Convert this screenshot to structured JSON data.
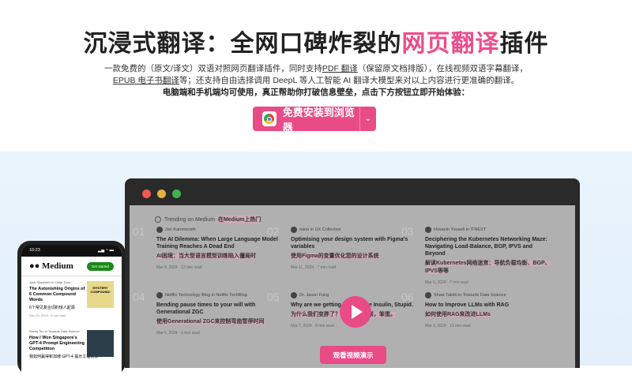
{
  "hero": {
    "title_pre": "沉浸式翻译：全网口碑炸裂的",
    "title_hl": "网页翻译",
    "title_post": "插件",
    "desc1": "一款免费的（原文/译文）双语对照网页翻译插件，同时支持",
    "pdf_link": "PDF 翻译",
    "desc2": "（保留原文档排版），在线视频双语字幕翻译，",
    "epub_link": "EPUB 电子书翻译",
    "desc3": "等；还支持自由选择调用 DeepL 等人工智能 AI 翻译大模型来对以上内容进行更准确的翻译。",
    "desc_bold": "电脑端和手机端均可使用，真正帮助你打破信息壁垒，点击下方按钮立即开始体验：",
    "install_label": "免费安装到浏览器",
    "dropdown_icon": "chevron-down-icon"
  },
  "colors": {
    "accent": "#e94b87"
  },
  "demo": {
    "trending": "Trending on Medium",
    "trending_zh": "在Medium上热门",
    "watch_label": "观看视频演示",
    "cards": [
      {
        "num": "01",
        "author": "Jan Kammerath",
        "title": "The AI Dilemma: When Large Language Model Training Reaches A Dead End",
        "zh": "AI困境：当大型语言模型训练陷入僵局时",
        "meta": "Mar 9, 2024 · 12 min read"
      },
      {
        "num": "02",
        "author": "nana in UX Collective",
        "title": "Optimising your design system with Figma's variables",
        "zh": "使用Figma的变量优化您的设计系统",
        "meta": "Mar 11, 2024 · 7 min read"
      },
      {
        "num": "03",
        "author": "Hossein Yousefi in ITNEXT",
        "title": "Deciphering the Kubernetes Networking Maze: Navigating Load-Balance, BGP, IPVS and Beyond",
        "zh": "解读Kubernetes网络迷宫：导航负载均衡、BGP、IPVS等等",
        "meta": "Mar 6, 2024 · 7 min read"
      },
      {
        "num": "04",
        "author": "Netflix Technology Blog in Netflix TechBlog",
        "title": "Bending pause times to your will with Generational ZGC",
        "zh": "使用Generational ZGC来控制弯曲暂停时间",
        "meta": "Mar 6, 2024 · 6 min read"
      },
      {
        "num": "05",
        "author": "Dr. Jason Fung",
        "title": "Why are we getting fat? It's the Insulin, Stupid.",
        "zh": "为什么我们变胖了？是因为胰岛素，笨蛋。",
        "meta": "Mar 7, 2024 · 8 min read"
      },
      {
        "num": "06",
        "author": "Shaw Talebi in Towards Data Science",
        "title": "How to Improve LLMs with RAG",
        "zh": "如何使用RAG来改进LLMs",
        "meta": "Mar 9, 2024 · 12 min read"
      }
    ]
  },
  "phone": {
    "time": "10:23",
    "logo": "Medium",
    "get_started": "Get started",
    "items": [
      {
        "author": "Jack Shepherd in Cellar Door",
        "title": "The Astonishing Origins of 6 Common Compound Words",
        "zh": "6个常见复合词的惊人起源",
        "meta": "Dec 20, 2023 · 5 min read",
        "img": "MYSTERY COMPOUND!"
      },
      {
        "author": "Sheila Teo in Towards Data Science",
        "title": "How I Won Singapore's GPT-4 Prompt Engineering Competition",
        "zh": "我如何赢得新加坡 GPT-4 提示工程比赛",
        "meta": ""
      }
    ]
  }
}
